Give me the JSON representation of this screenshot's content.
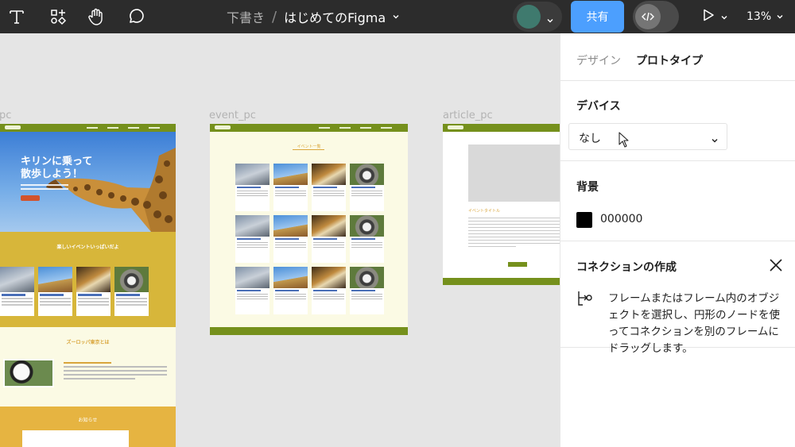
{
  "toolbar": {
    "breadcrumb_draft": "下書き",
    "breadcrumb_sep": "/",
    "file_name": "はじめてのFigma",
    "share_label": "共有",
    "zoom_label": "13%",
    "avatar_color": "#3f7a6e",
    "share_color": "#4c9ffe",
    "icons": [
      "text-tool-icon",
      "resources-icon",
      "hand-tool-icon",
      "comment-icon",
      "chevron-down-icon",
      "dev-mode-icon",
      "play-icon"
    ]
  },
  "canvas": {
    "frames": [
      {
        "label": "top_pc",
        "visible_label": "pc"
      },
      {
        "label": "event_pc"
      },
      {
        "label": "article_pc"
      }
    ],
    "top": {
      "hero_title": "キリンに乗って\n散歩しよう！",
      "band_title": "楽しいイベントいっぱいだよ",
      "about_title": "ズーロッパ東京とは",
      "news_title": "お知らせ"
    },
    "event": {
      "title": "イベント一覧"
    },
    "article": {
      "title": "イベントタイトル"
    }
  },
  "panel": {
    "tab_design": "デザイン",
    "tab_prototype": "プロトタイプ",
    "device": {
      "title": "デバイス",
      "value": "なし"
    },
    "background": {
      "title": "背景",
      "hex": "000000",
      "swatch_color": "#000000"
    },
    "connection": {
      "title": "コネクションの作成",
      "help": "フレームまたはフレーム内のオブジェクトを選択し、円形のノードを使ってコネクションを別のフレームにドラッグします。"
    }
  }
}
